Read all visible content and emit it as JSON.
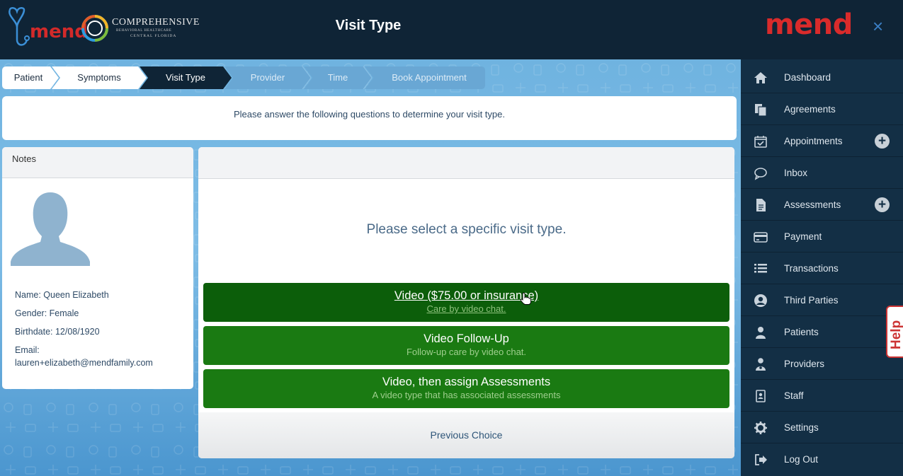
{
  "header": {
    "brand": "mend",
    "partner_line1": "COMPREHENSIVE",
    "partner_line2": "BEHAVIORAL HEALTHCARE",
    "partner_line3": "CENTRAL FLORIDA",
    "title": "Visit Type"
  },
  "steps": [
    {
      "label": "Patient",
      "state": "done"
    },
    {
      "label": "Symptoms",
      "state": "done"
    },
    {
      "label": "Visit Type",
      "state": "active"
    },
    {
      "label": "Provider",
      "state": "pending"
    },
    {
      "label": "Time",
      "state": "pending"
    },
    {
      "label": "Book Appointment",
      "state": "pending"
    }
  ],
  "intro_text": "Please answer the following questions to determine your visit type.",
  "notes": {
    "heading": "Notes",
    "name": "Name: Queen Elizabeth",
    "gender": "Gender: Female",
    "birthdate": "Birthdate: 12/08/1920",
    "email_label": "Email:",
    "email": "lauren+elizabeth@mendfamily.com"
  },
  "selection": {
    "prompt": "Please select a specific visit type.",
    "options": [
      {
        "title": "Video ($75.00 or insurance)",
        "desc": "Care by video chat."
      },
      {
        "title": "Video Follow-Up",
        "desc": "Follow-up care by video chat."
      },
      {
        "title": "Video, then assign Assessments",
        "desc": "A video type that has associated assessments"
      }
    ],
    "back": "Previous Choice"
  },
  "sidebar": {
    "brand": "mend",
    "close": "×",
    "items": [
      {
        "label": "Dashboard",
        "icon": "home-icon"
      },
      {
        "label": "Agreements",
        "icon": "documents-icon"
      },
      {
        "label": "Appointments",
        "icon": "calendar-check-icon",
        "plus": "+"
      },
      {
        "label": "Inbox",
        "icon": "chat-bubble-icon"
      },
      {
        "label": "Assessments",
        "icon": "document-icon",
        "plus": "+"
      },
      {
        "label": "Payment",
        "icon": "credit-card-icon"
      },
      {
        "label": "Transactions",
        "icon": "list-icon"
      },
      {
        "label": "Third Parties",
        "icon": "user-circle-icon"
      },
      {
        "label": "Patients",
        "icon": "user-icon"
      },
      {
        "label": "Providers",
        "icon": "doctor-icon"
      },
      {
        "label": "Staff",
        "icon": "id-badge-icon"
      },
      {
        "label": "Settings",
        "icon": "gear-icon"
      },
      {
        "label": "Log Out",
        "icon": "sign-out-icon"
      }
    ]
  },
  "help_label": "Help",
  "colors": {
    "header_bg": "#0f2436",
    "sidebar_bg": "#132f45",
    "brand_red": "#d92b2b",
    "option_green": "#1a7a12",
    "option_green_active": "#0c5e0a"
  }
}
